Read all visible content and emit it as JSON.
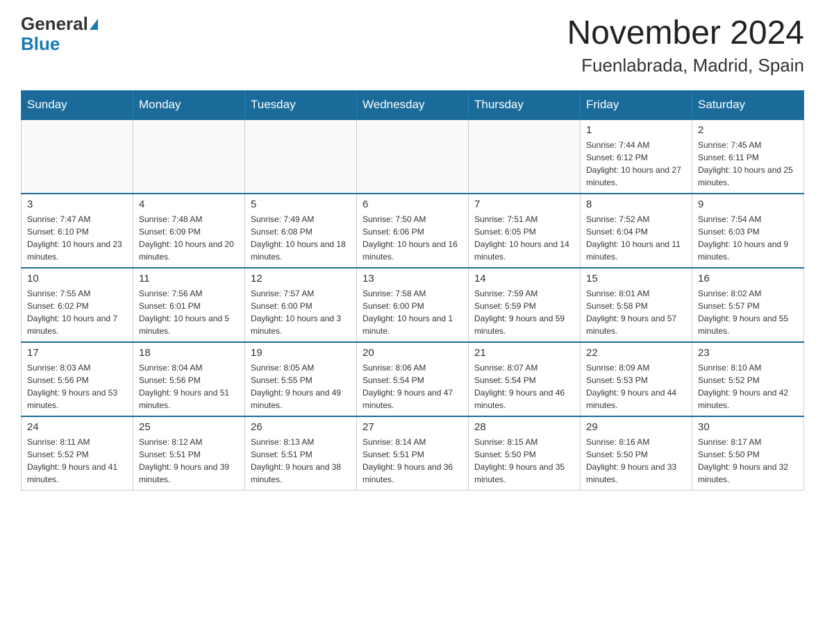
{
  "header": {
    "logo_general": "General",
    "logo_blue": "Blue",
    "title": "November 2024",
    "subtitle": "Fuenlabrada, Madrid, Spain"
  },
  "days_of_week": [
    "Sunday",
    "Monday",
    "Tuesday",
    "Wednesday",
    "Thursday",
    "Friday",
    "Saturday"
  ],
  "weeks": [
    [
      {
        "day": "",
        "sunrise": "",
        "sunset": "",
        "daylight": ""
      },
      {
        "day": "",
        "sunrise": "",
        "sunset": "",
        "daylight": ""
      },
      {
        "day": "",
        "sunrise": "",
        "sunset": "",
        "daylight": ""
      },
      {
        "day": "",
        "sunrise": "",
        "sunset": "",
        "daylight": ""
      },
      {
        "day": "",
        "sunrise": "",
        "sunset": "",
        "daylight": ""
      },
      {
        "day": "1",
        "sunrise": "Sunrise: 7:44 AM",
        "sunset": "Sunset: 6:12 PM",
        "daylight": "Daylight: 10 hours and 27 minutes."
      },
      {
        "day": "2",
        "sunrise": "Sunrise: 7:45 AM",
        "sunset": "Sunset: 6:11 PM",
        "daylight": "Daylight: 10 hours and 25 minutes."
      }
    ],
    [
      {
        "day": "3",
        "sunrise": "Sunrise: 7:47 AM",
        "sunset": "Sunset: 6:10 PM",
        "daylight": "Daylight: 10 hours and 23 minutes."
      },
      {
        "day": "4",
        "sunrise": "Sunrise: 7:48 AM",
        "sunset": "Sunset: 6:09 PM",
        "daylight": "Daylight: 10 hours and 20 minutes."
      },
      {
        "day": "5",
        "sunrise": "Sunrise: 7:49 AM",
        "sunset": "Sunset: 6:08 PM",
        "daylight": "Daylight: 10 hours and 18 minutes."
      },
      {
        "day": "6",
        "sunrise": "Sunrise: 7:50 AM",
        "sunset": "Sunset: 6:06 PM",
        "daylight": "Daylight: 10 hours and 16 minutes."
      },
      {
        "day": "7",
        "sunrise": "Sunrise: 7:51 AM",
        "sunset": "Sunset: 6:05 PM",
        "daylight": "Daylight: 10 hours and 14 minutes."
      },
      {
        "day": "8",
        "sunrise": "Sunrise: 7:52 AM",
        "sunset": "Sunset: 6:04 PM",
        "daylight": "Daylight: 10 hours and 11 minutes."
      },
      {
        "day": "9",
        "sunrise": "Sunrise: 7:54 AM",
        "sunset": "Sunset: 6:03 PM",
        "daylight": "Daylight: 10 hours and 9 minutes."
      }
    ],
    [
      {
        "day": "10",
        "sunrise": "Sunrise: 7:55 AM",
        "sunset": "Sunset: 6:02 PM",
        "daylight": "Daylight: 10 hours and 7 minutes."
      },
      {
        "day": "11",
        "sunrise": "Sunrise: 7:56 AM",
        "sunset": "Sunset: 6:01 PM",
        "daylight": "Daylight: 10 hours and 5 minutes."
      },
      {
        "day": "12",
        "sunrise": "Sunrise: 7:57 AM",
        "sunset": "Sunset: 6:00 PM",
        "daylight": "Daylight: 10 hours and 3 minutes."
      },
      {
        "day": "13",
        "sunrise": "Sunrise: 7:58 AM",
        "sunset": "Sunset: 6:00 PM",
        "daylight": "Daylight: 10 hours and 1 minute."
      },
      {
        "day": "14",
        "sunrise": "Sunrise: 7:59 AM",
        "sunset": "Sunset: 5:59 PM",
        "daylight": "Daylight: 9 hours and 59 minutes."
      },
      {
        "day": "15",
        "sunrise": "Sunrise: 8:01 AM",
        "sunset": "Sunset: 5:58 PM",
        "daylight": "Daylight: 9 hours and 57 minutes."
      },
      {
        "day": "16",
        "sunrise": "Sunrise: 8:02 AM",
        "sunset": "Sunset: 5:57 PM",
        "daylight": "Daylight: 9 hours and 55 minutes."
      }
    ],
    [
      {
        "day": "17",
        "sunrise": "Sunrise: 8:03 AM",
        "sunset": "Sunset: 5:56 PM",
        "daylight": "Daylight: 9 hours and 53 minutes."
      },
      {
        "day": "18",
        "sunrise": "Sunrise: 8:04 AM",
        "sunset": "Sunset: 5:56 PM",
        "daylight": "Daylight: 9 hours and 51 minutes."
      },
      {
        "day": "19",
        "sunrise": "Sunrise: 8:05 AM",
        "sunset": "Sunset: 5:55 PM",
        "daylight": "Daylight: 9 hours and 49 minutes."
      },
      {
        "day": "20",
        "sunrise": "Sunrise: 8:06 AM",
        "sunset": "Sunset: 5:54 PM",
        "daylight": "Daylight: 9 hours and 47 minutes."
      },
      {
        "day": "21",
        "sunrise": "Sunrise: 8:07 AM",
        "sunset": "Sunset: 5:54 PM",
        "daylight": "Daylight: 9 hours and 46 minutes."
      },
      {
        "day": "22",
        "sunrise": "Sunrise: 8:09 AM",
        "sunset": "Sunset: 5:53 PM",
        "daylight": "Daylight: 9 hours and 44 minutes."
      },
      {
        "day": "23",
        "sunrise": "Sunrise: 8:10 AM",
        "sunset": "Sunset: 5:52 PM",
        "daylight": "Daylight: 9 hours and 42 minutes."
      }
    ],
    [
      {
        "day": "24",
        "sunrise": "Sunrise: 8:11 AM",
        "sunset": "Sunset: 5:52 PM",
        "daylight": "Daylight: 9 hours and 41 minutes."
      },
      {
        "day": "25",
        "sunrise": "Sunrise: 8:12 AM",
        "sunset": "Sunset: 5:51 PM",
        "daylight": "Daylight: 9 hours and 39 minutes."
      },
      {
        "day": "26",
        "sunrise": "Sunrise: 8:13 AM",
        "sunset": "Sunset: 5:51 PM",
        "daylight": "Daylight: 9 hours and 38 minutes."
      },
      {
        "day": "27",
        "sunrise": "Sunrise: 8:14 AM",
        "sunset": "Sunset: 5:51 PM",
        "daylight": "Daylight: 9 hours and 36 minutes."
      },
      {
        "day": "28",
        "sunrise": "Sunrise: 8:15 AM",
        "sunset": "Sunset: 5:50 PM",
        "daylight": "Daylight: 9 hours and 35 minutes."
      },
      {
        "day": "29",
        "sunrise": "Sunrise: 8:16 AM",
        "sunset": "Sunset: 5:50 PM",
        "daylight": "Daylight: 9 hours and 33 minutes."
      },
      {
        "day": "30",
        "sunrise": "Sunrise: 8:17 AM",
        "sunset": "Sunset: 5:50 PM",
        "daylight": "Daylight: 9 hours and 32 minutes."
      }
    ]
  ]
}
